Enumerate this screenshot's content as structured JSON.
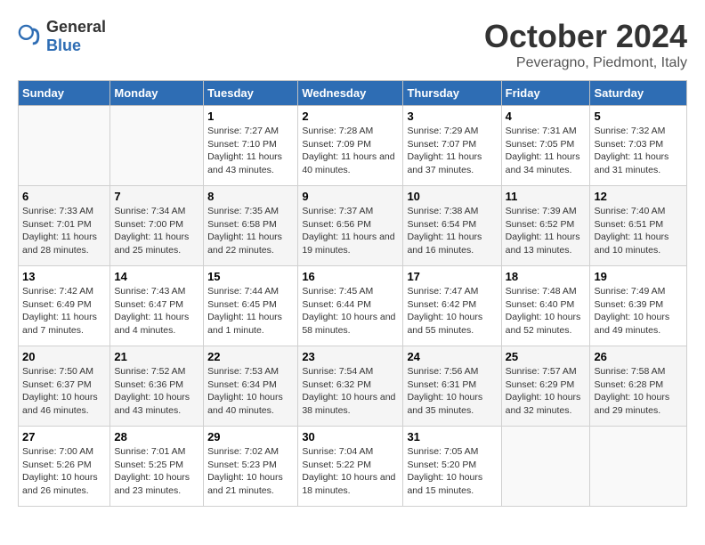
{
  "header": {
    "logo_general": "General",
    "logo_blue": "Blue",
    "month_title": "October 2024",
    "location": "Peveragno, Piedmont, Italy"
  },
  "days_of_week": [
    "Sunday",
    "Monday",
    "Tuesday",
    "Wednesday",
    "Thursday",
    "Friday",
    "Saturday"
  ],
  "weeks": [
    [
      {
        "day": "",
        "content": ""
      },
      {
        "day": "",
        "content": ""
      },
      {
        "day": "1",
        "content": "Sunrise: 7:27 AM\nSunset: 7:10 PM\nDaylight: 11 hours and 43 minutes."
      },
      {
        "day": "2",
        "content": "Sunrise: 7:28 AM\nSunset: 7:09 PM\nDaylight: 11 hours and 40 minutes."
      },
      {
        "day": "3",
        "content": "Sunrise: 7:29 AM\nSunset: 7:07 PM\nDaylight: 11 hours and 37 minutes."
      },
      {
        "day": "4",
        "content": "Sunrise: 7:31 AM\nSunset: 7:05 PM\nDaylight: 11 hours and 34 minutes."
      },
      {
        "day": "5",
        "content": "Sunrise: 7:32 AM\nSunset: 7:03 PM\nDaylight: 11 hours and 31 minutes."
      }
    ],
    [
      {
        "day": "6",
        "content": "Sunrise: 7:33 AM\nSunset: 7:01 PM\nDaylight: 11 hours and 28 minutes."
      },
      {
        "day": "7",
        "content": "Sunrise: 7:34 AM\nSunset: 7:00 PM\nDaylight: 11 hours and 25 minutes."
      },
      {
        "day": "8",
        "content": "Sunrise: 7:35 AM\nSunset: 6:58 PM\nDaylight: 11 hours and 22 minutes."
      },
      {
        "day": "9",
        "content": "Sunrise: 7:37 AM\nSunset: 6:56 PM\nDaylight: 11 hours and 19 minutes."
      },
      {
        "day": "10",
        "content": "Sunrise: 7:38 AM\nSunset: 6:54 PM\nDaylight: 11 hours and 16 minutes."
      },
      {
        "day": "11",
        "content": "Sunrise: 7:39 AM\nSunset: 6:52 PM\nDaylight: 11 hours and 13 minutes."
      },
      {
        "day": "12",
        "content": "Sunrise: 7:40 AM\nSunset: 6:51 PM\nDaylight: 11 hours and 10 minutes."
      }
    ],
    [
      {
        "day": "13",
        "content": "Sunrise: 7:42 AM\nSunset: 6:49 PM\nDaylight: 11 hours and 7 minutes."
      },
      {
        "day": "14",
        "content": "Sunrise: 7:43 AM\nSunset: 6:47 PM\nDaylight: 11 hours and 4 minutes."
      },
      {
        "day": "15",
        "content": "Sunrise: 7:44 AM\nSunset: 6:45 PM\nDaylight: 11 hours and 1 minute."
      },
      {
        "day": "16",
        "content": "Sunrise: 7:45 AM\nSunset: 6:44 PM\nDaylight: 10 hours and 58 minutes."
      },
      {
        "day": "17",
        "content": "Sunrise: 7:47 AM\nSunset: 6:42 PM\nDaylight: 10 hours and 55 minutes."
      },
      {
        "day": "18",
        "content": "Sunrise: 7:48 AM\nSunset: 6:40 PM\nDaylight: 10 hours and 52 minutes."
      },
      {
        "day": "19",
        "content": "Sunrise: 7:49 AM\nSunset: 6:39 PM\nDaylight: 10 hours and 49 minutes."
      }
    ],
    [
      {
        "day": "20",
        "content": "Sunrise: 7:50 AM\nSunset: 6:37 PM\nDaylight: 10 hours and 46 minutes."
      },
      {
        "day": "21",
        "content": "Sunrise: 7:52 AM\nSunset: 6:36 PM\nDaylight: 10 hours and 43 minutes."
      },
      {
        "day": "22",
        "content": "Sunrise: 7:53 AM\nSunset: 6:34 PM\nDaylight: 10 hours and 40 minutes."
      },
      {
        "day": "23",
        "content": "Sunrise: 7:54 AM\nSunset: 6:32 PM\nDaylight: 10 hours and 38 minutes."
      },
      {
        "day": "24",
        "content": "Sunrise: 7:56 AM\nSunset: 6:31 PM\nDaylight: 10 hours and 35 minutes."
      },
      {
        "day": "25",
        "content": "Sunrise: 7:57 AM\nSunset: 6:29 PM\nDaylight: 10 hours and 32 minutes."
      },
      {
        "day": "26",
        "content": "Sunrise: 7:58 AM\nSunset: 6:28 PM\nDaylight: 10 hours and 29 minutes."
      }
    ],
    [
      {
        "day": "27",
        "content": "Sunrise: 7:00 AM\nSunset: 5:26 PM\nDaylight: 10 hours and 26 minutes."
      },
      {
        "day": "28",
        "content": "Sunrise: 7:01 AM\nSunset: 5:25 PM\nDaylight: 10 hours and 23 minutes."
      },
      {
        "day": "29",
        "content": "Sunrise: 7:02 AM\nSunset: 5:23 PM\nDaylight: 10 hours and 21 minutes."
      },
      {
        "day": "30",
        "content": "Sunrise: 7:04 AM\nSunset: 5:22 PM\nDaylight: 10 hours and 18 minutes."
      },
      {
        "day": "31",
        "content": "Sunrise: 7:05 AM\nSunset: 5:20 PM\nDaylight: 10 hours and 15 minutes."
      },
      {
        "day": "",
        "content": ""
      },
      {
        "day": "",
        "content": ""
      }
    ]
  ]
}
